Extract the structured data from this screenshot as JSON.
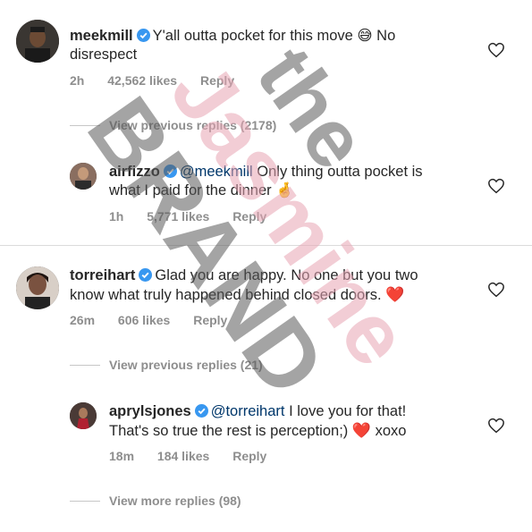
{
  "colors": {
    "accent_link": "#00376b",
    "muted": "#8e8e8e",
    "heart_red": "#ed1c24",
    "verified_blue": "#3897f0"
  },
  "comments": [
    {
      "username": "meekmill",
      "text_a": "Y'all outta pocket for this move 😅  No",
      "text_b": "disrespect",
      "time": "2h",
      "likes": "42,562 likes",
      "reply": "Reply"
    },
    {
      "username": "airfizzo",
      "mention": "@meekmill",
      "text_a": " Only thing outta pocket is",
      "text_b": "what I paid for the dinner 🤞",
      "time": "1h",
      "likes": "5,771 likes",
      "reply": "Reply"
    },
    {
      "username": "torreihart",
      "text_a": "Glad you are happy. No one but you two",
      "text_b": "know what truly happened behind closed doors. ",
      "text_emoji": "❤️",
      "time": "26m",
      "likes": "606 likes",
      "reply": "Reply"
    },
    {
      "username": "aprylsjones",
      "mention": "@torreihart",
      "text_a": " I love you for that!",
      "text_b": "That's so true the rest is perception;) ",
      "text_emoji": "❤️",
      "text_c": " xoxo",
      "time": "18m",
      "likes": "184 likes",
      "reply": "Reply"
    }
  ],
  "view_previous_1": "View previous replies (2178)",
  "view_previous_2": "View previous replies (21)",
  "view_more": "View more replies (98)",
  "watermark": {
    "line1": "the",
    "line2": "Jasmine",
    "line3": "BRAND"
  },
  "icons": {
    "like": "heart-outline-icon",
    "verified": "verified-badge-icon"
  }
}
